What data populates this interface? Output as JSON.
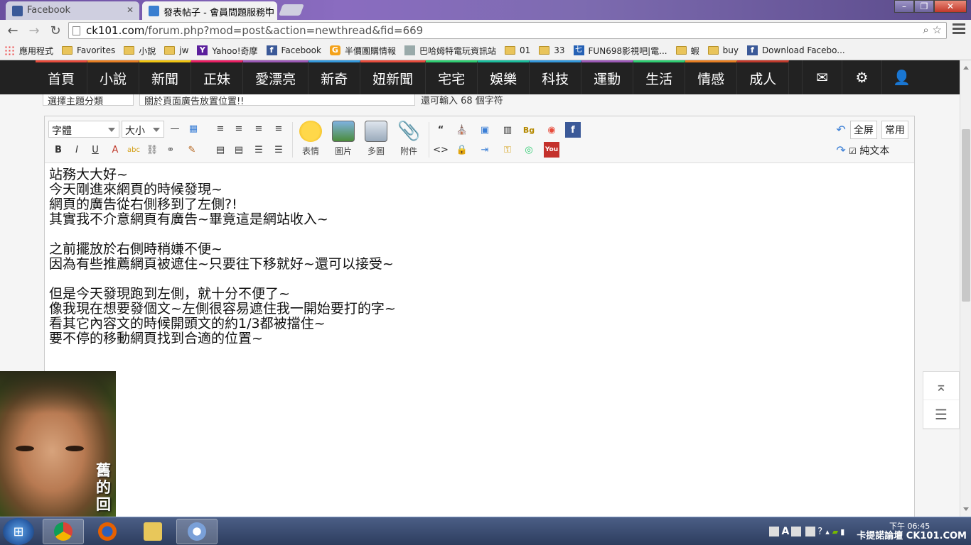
{
  "browser": {
    "tabs": [
      {
        "title": "Facebook",
        "active": false
      },
      {
        "title": "發表帖子 - 會員問題服務中",
        "active": true
      }
    ],
    "url_host": "ck101.com",
    "url_path": "/forum.php?mod=post&action=newthread&fid=669"
  },
  "bookmarks": [
    {
      "label": "應用程式",
      "icon": "apps-icon"
    },
    {
      "label": "Favorites",
      "icon": "folder-icon"
    },
    {
      "label": "小說",
      "icon": "folder-icon"
    },
    {
      "label": "jw",
      "icon": "folder-icon"
    },
    {
      "label": "Yahoo!奇摩",
      "icon": "yahoo-icon"
    },
    {
      "label": "Facebook",
      "icon": "facebook-icon"
    },
    {
      "label": "半價團購情報",
      "icon": "g-icon"
    },
    {
      "label": "巴哈姆特電玩資訊站",
      "icon": "bahamut-icon"
    },
    {
      "label": "01",
      "icon": "folder-icon"
    },
    {
      "label": "33",
      "icon": "folder-icon"
    },
    {
      "label": "FUN698影視吧|電...",
      "icon": "fun698-icon"
    },
    {
      "label": "蝦",
      "icon": "folder-icon"
    },
    {
      "label": "buy",
      "icon": "folder-icon"
    },
    {
      "label": "Download Facebo...",
      "icon": "facebook-icon"
    }
  ],
  "nav": {
    "items": [
      "首頁",
      "小說",
      "新聞",
      "正妹",
      "愛漂亮",
      "新奇",
      "妞新聞",
      "宅宅",
      "娛樂",
      "科技",
      "運動",
      "生活",
      "情感",
      "成人"
    ],
    "colors": [
      "#e74c3c",
      "#e67e22",
      "#f1c40f",
      "#e91e63",
      "#9b59b6",
      "#3498db",
      "#e74c3c",
      "#2ecc71",
      "#1abc9c",
      "#3498db",
      "#9b59b6",
      "#2ecc71",
      "#e67e22",
      "#c0392b"
    ]
  },
  "form": {
    "topic_select": "選擇主題分類",
    "subject_value": "關於頁面廣告放置位置!!",
    "subject_hint": "還可輸入 68 個字符"
  },
  "editor": {
    "font_select": "字體",
    "size_select": "大小",
    "buttons": {
      "emoji": "表情",
      "image": "圖片",
      "multi_image": "多圖",
      "attach": "附件"
    },
    "fullscreen": "全屏",
    "common": "常用",
    "plain_text": "純文本",
    "content": "站務大大好~\n今天剛進來網頁的時候發現~\n網頁的廣告從右側移到了左側?!\n其實我不介意網頁有廣告~畢竟這是網站收入~\n\n之前擺放於右側時稍嫌不便~\n因為有些推薦網頁被遮住~只要往下移就好~還可以接受~\n\n但是今天發現跑到左側，就十分不便了~\n像我現在想要發個文~左側很容易遮住我一開始要打的字~\n看其它內容文的時候開頭文的約1/3都被擋住~\n要不停的移動網頁找到合適的位置~"
  },
  "ad": {
    "text": "舊的回"
  },
  "taskbar": {
    "time": "下午 06:45",
    "watermark": "卡提諾論壇 CK101.COM"
  }
}
